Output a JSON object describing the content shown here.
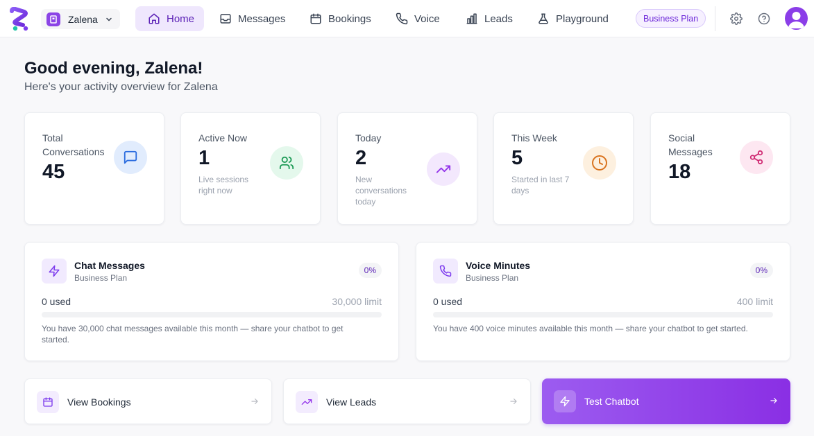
{
  "nav": {
    "workspace": "Zalena",
    "items": [
      {
        "label": "Home",
        "icon": "home-icon",
        "active": true
      },
      {
        "label": "Messages",
        "icon": "inbox-icon"
      },
      {
        "label": "Bookings",
        "icon": "calendar-icon"
      },
      {
        "label": "Voice",
        "icon": "phone-icon"
      },
      {
        "label": "Leads",
        "icon": "bar-chart-icon"
      },
      {
        "label": "Playground",
        "icon": "flask-icon"
      }
    ],
    "plan": "Business Plan"
  },
  "header": {
    "greeting": "Good evening, Zalena!",
    "subtitle": "Here's your activity overview for Zalena"
  },
  "stats": [
    {
      "label": "Total Conversations",
      "value": "45",
      "sub": "",
      "icon": "chat-icon",
      "color": "#e1ecfd",
      "stroke": "#2b6cdf"
    },
    {
      "label": "Active Now",
      "value": "1",
      "sub": "Live sessions right now",
      "icon": "users-icon",
      "color": "#e4f8ec",
      "stroke": "#1c9a55"
    },
    {
      "label": "Today",
      "value": "2",
      "sub": "New conversations today",
      "icon": "trending-up-icon",
      "color": "#f3e8fd",
      "stroke": "#9333ea"
    },
    {
      "label": "This Week",
      "value": "5",
      "sub": "Started in last 7 days",
      "icon": "clock-icon",
      "color": "#fdf0df",
      "stroke": "#d9731f"
    },
    {
      "label": "Social Messages",
      "value": "18",
      "sub": "",
      "icon": "share-icon",
      "color": "#fde7f1",
      "stroke": "#d02c74"
    }
  ],
  "usage": [
    {
      "title": "Chat Messages",
      "plan": "Business Plan",
      "pct": "0%",
      "fraction": 0,
      "used": "0 used",
      "limit": "30,000 limit",
      "note": "You have 30,000 chat messages available this month — share your chatbot to get started.",
      "icon": "lightning-icon"
    },
    {
      "title": "Voice Minutes",
      "plan": "Business Plan",
      "pct": "0%",
      "fraction": 0,
      "used": "0 used",
      "limit": "400 limit",
      "note": "You have 400 voice minutes available this month — share your chatbot to get started.",
      "icon": "phone-icon"
    }
  ],
  "actions": [
    {
      "label": "View Bookings",
      "icon": "calendar-icon"
    },
    {
      "label": "View Leads",
      "icon": "trending-up-icon"
    },
    {
      "label": "Test Chatbot",
      "icon": "lightning-icon"
    }
  ],
  "colors": {
    "accent": "#8b44e6",
    "accent_light": "#efe7fd"
  }
}
